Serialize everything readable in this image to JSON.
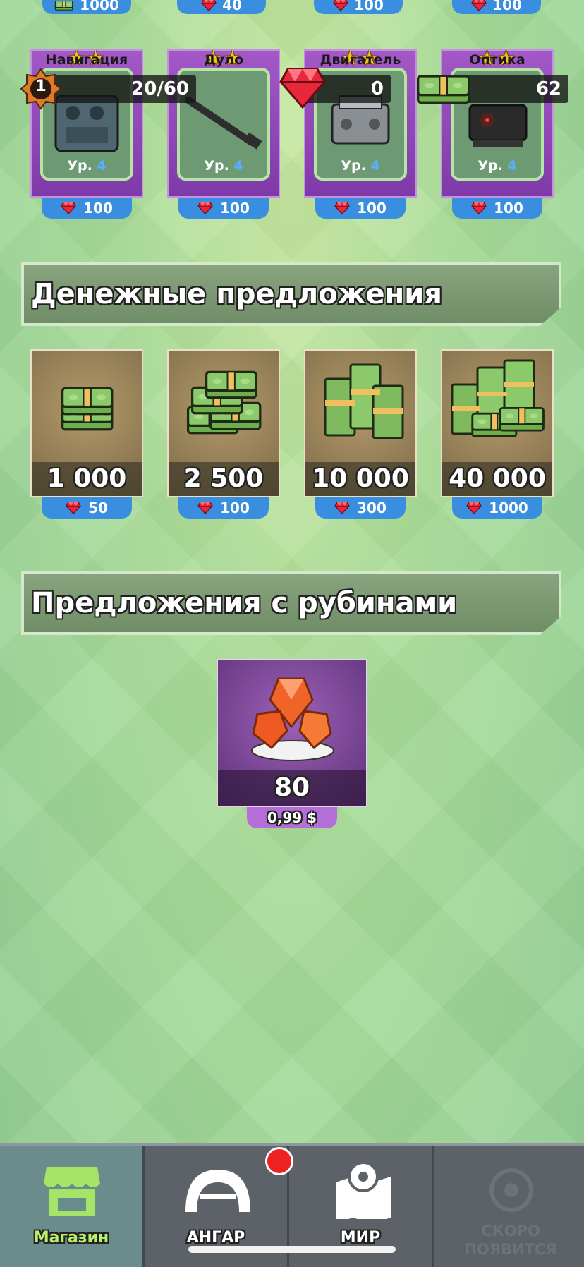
{
  "colors": {
    "accent_blue": "#3a8ee0",
    "purple_card": "#8e48b6",
    "active_tab": "#6b8c8d",
    "nav_bg": "#5c6268",
    "active_label": "#b8f06a"
  },
  "top_tags": [
    {
      "value": "1000",
      "icon": "cash-icon"
    },
    {
      "value": "40",
      "icon": "ruby-icon"
    },
    {
      "value": "100",
      "icon": "ruby-icon"
    },
    {
      "value": "100",
      "icon": "ruby-icon"
    }
  ],
  "hud": {
    "level": "1",
    "xp": "20/60",
    "rubies": "0",
    "money": "62"
  },
  "components": [
    {
      "name": "Навигация",
      "level_prefix": "Ур.",
      "level": "4",
      "price": "100",
      "stars": "★★",
      "icon": "navigation-panel-icon"
    },
    {
      "name": "Дуло",
      "level_prefix": "Ур.",
      "level": "4",
      "price": "100",
      "stars": "★★",
      "icon": "barrel-icon"
    },
    {
      "name": "Двигатель",
      "level_prefix": "Ур.",
      "level": "4",
      "price": "100",
      "stars": "★★",
      "icon": "engine-icon"
    },
    {
      "name": "Оптика",
      "level_prefix": "Ур.",
      "level": "4",
      "price": "100",
      "stars": "★★",
      "icon": "optics-icon"
    }
  ],
  "money_section": {
    "title": "Денежные предложения",
    "offers": [
      {
        "amount": "1 000",
        "price": "50"
      },
      {
        "amount": "2 500",
        "price": "100"
      },
      {
        "amount": "10 000",
        "price": "300"
      },
      {
        "amount": "40 000",
        "price": "1000"
      }
    ]
  },
  "ruby_section": {
    "title": "Предложения с рубинами",
    "offers": [
      {
        "amount": "80",
        "price": "0,99 $"
      }
    ]
  },
  "nav": {
    "tabs": [
      {
        "label": "Магазин",
        "icon": "shop-icon",
        "active": true
      },
      {
        "label": "АНГАР",
        "icon": "hangar-icon",
        "active": false
      },
      {
        "label": "МИР",
        "icon": "map-icon",
        "active": false
      },
      {
        "label": "СКОРО ПОЯВИТСЯ",
        "icon": "coming-soon-icon",
        "active": false
      }
    ]
  }
}
